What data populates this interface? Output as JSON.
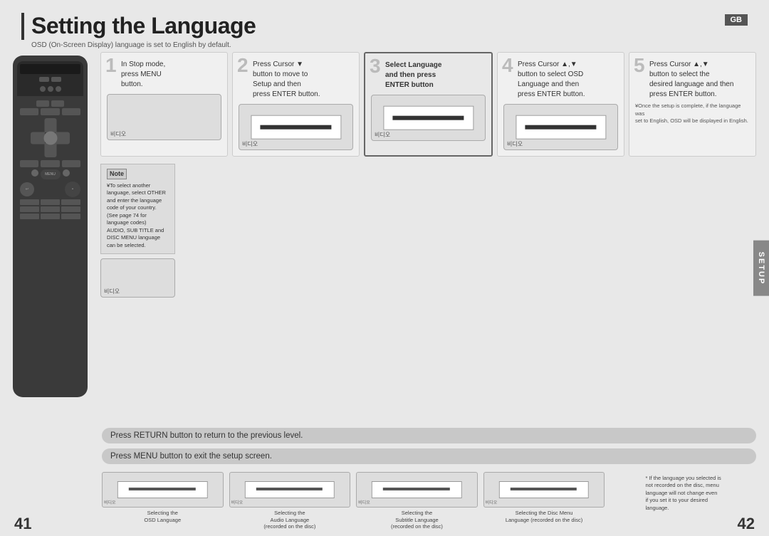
{
  "header": {
    "title": "Setting the Language",
    "subtitle": "OSD (On-Screen Display) language is set to English by default.",
    "gb_label": "GB"
  },
  "steps": [
    {
      "number": "1",
      "text": "In Stop mode,\npress MENU\nbutton."
    },
    {
      "number": "2",
      "text": "Press Cursor ▼\nbutton to move to\nSetup  and then\npress ENTER button."
    },
    {
      "number": "3",
      "text": "Select  Language\nand then press\nENTER button"
    },
    {
      "number": "4",
      "text": "Press Cursor ▲,▼\nbutton to select  OSD\nLanguage  and then\npress ENTER button."
    },
    {
      "number": "5",
      "text": "Press Cursor ▲,▼\nbutton to select the\ndesired language and then\npress ENTER button."
    }
  ],
  "step5_note": "¥Once the setup is complete, if the language was\nset to English, OSD will be displayed in English.",
  "notices": [
    "Press RETURN button to return to the previous level.",
    "Press MENU button to exit the setup screen."
  ],
  "note": {
    "title": "Note",
    "lines": [
      "¥To select another language, select OTHER and enter the language code of your country.",
      "(See page 74 for language codes)",
      "AUDIO, SUB TITLE and DISC MENU language can be selected."
    ]
  },
  "bottom_screens": [
    {
      "label": "Selecting the\nOSD Language"
    },
    {
      "label": "Selecting the\nAudio Language\n(recorded on the disc)"
    },
    {
      "label": "Selecting the\nSubtitle Language\n(recorded on the disc)"
    },
    {
      "label": "Selecting the Disc Menu\nLanguage (recorded on the disc)"
    }
  ],
  "bottom_note": "* If the language you selected is\nnot recorded on the disc, menu\nlanguage will not change even\nif you set it to your desired\nlanguage.",
  "screen_label": "비디오",
  "setup_label": "SETUP",
  "page_numbers": {
    "left": "41",
    "right": "42"
  }
}
